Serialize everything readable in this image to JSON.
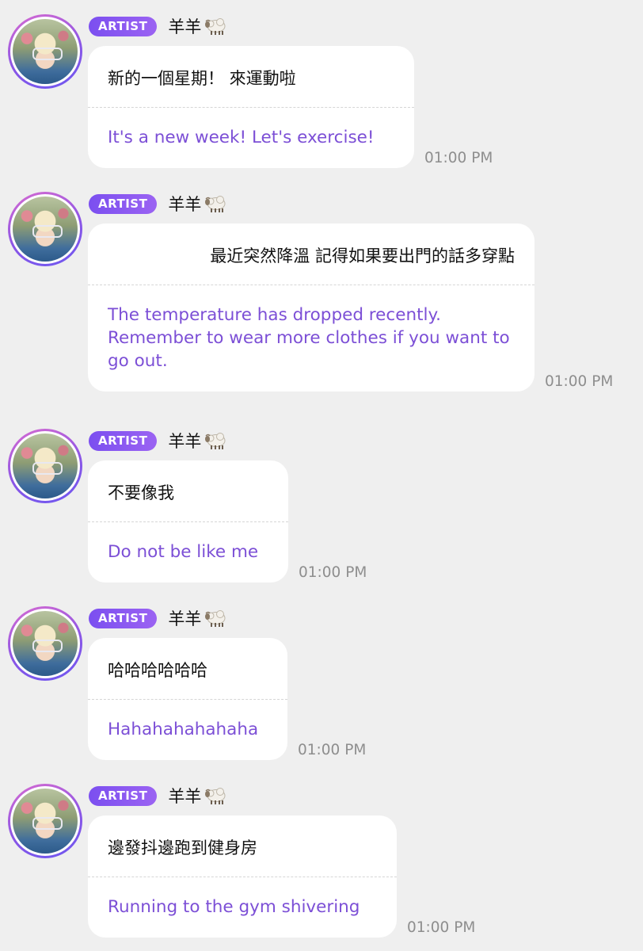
{
  "messages": [
    {
      "badge": "ARTIST",
      "name": "羊羊",
      "icon": "sheep-icon",
      "original": "新的一個星期！ 來運動啦",
      "translation": "It's a new week! Let's exercise!",
      "time": "01:00 PM"
    },
    {
      "badge": "ARTIST",
      "name": "羊羊",
      "icon": "sheep-icon",
      "original": "最近突然降溫 記得如果要出門的話多穿點",
      "translation": "The temperature has dropped recently. Remember to wear more clothes if you want to go out.",
      "time": "01:00 PM"
    },
    {
      "badge": "ARTIST",
      "name": "羊羊",
      "icon": "sheep-icon",
      "original": "不要像我",
      "translation": "Do not be like me",
      "time": "01:00 PM"
    },
    {
      "badge": "ARTIST",
      "name": "羊羊",
      "icon": "sheep-icon",
      "original": "哈哈哈哈哈哈",
      "translation": "Hahahahahahaha",
      "time": "01:00 PM"
    },
    {
      "badge": "ARTIST",
      "name": "羊羊",
      "icon": "sheep-icon",
      "original": "邊發抖邊跑到健身房",
      "translation": "Running to the gym shivering",
      "time": "01:00 PM"
    }
  ],
  "colors": {
    "background": "#efefef",
    "badge_accent": "#7b4ff0",
    "translation_text": "#7c4fd6",
    "timestamp": "#8e8e8e"
  }
}
